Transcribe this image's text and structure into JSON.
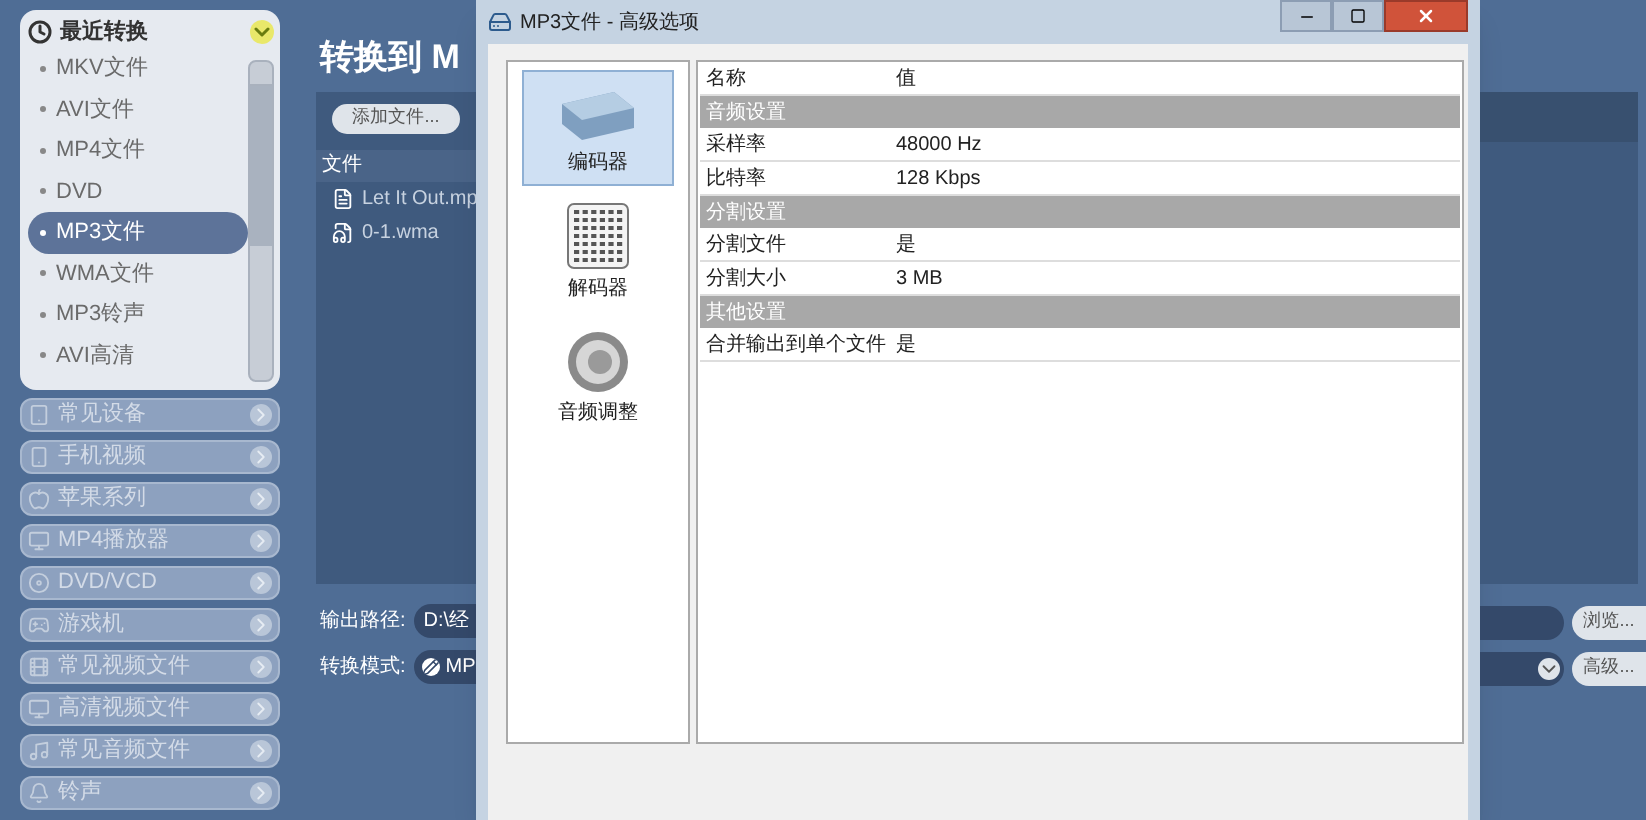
{
  "sidebar": {
    "recent": {
      "title": "最近转换",
      "items": [
        {
          "label": "MKV文件",
          "selected": false
        },
        {
          "label": "AVI文件",
          "selected": false
        },
        {
          "label": "MP4文件",
          "selected": false
        },
        {
          "label": "DVD",
          "selected": false
        },
        {
          "label": "MP3文件",
          "selected": true
        },
        {
          "label": "WMA文件",
          "selected": false
        },
        {
          "label": "MP3铃声",
          "selected": false
        },
        {
          "label": "AVI高清",
          "selected": false
        }
      ]
    },
    "categories": [
      {
        "label": "常见设备",
        "kind": "device"
      },
      {
        "label": "手机视频",
        "kind": "phone"
      },
      {
        "label": "苹果系列",
        "kind": "apple"
      },
      {
        "label": "MP4播放器",
        "kind": "player"
      },
      {
        "label": "DVD/VCD",
        "kind": "disc"
      },
      {
        "label": "游戏机",
        "kind": "game"
      },
      {
        "label": "常见视频文件",
        "kind": "video"
      },
      {
        "label": "高清视频文件",
        "kind": "hd"
      },
      {
        "label": "常见音频文件",
        "kind": "audio"
      },
      {
        "label": "铃声",
        "kind": "ring"
      }
    ]
  },
  "main": {
    "title": "转换到 M",
    "add_button": "添加文件...",
    "file_column": "文件",
    "files": [
      {
        "name": "Let It Out.mp",
        "kind": "document"
      },
      {
        "name": "0-1.wma",
        "kind": "audio"
      }
    ],
    "output_path_label": "输出路径:",
    "output_path": "D:\\经",
    "mode_label": "转换模式:",
    "mode": "MP",
    "browse_button": "浏览...",
    "advanced_button": "高级..."
  },
  "dialog": {
    "title": "MP3文件 - 高级选项",
    "nav": [
      {
        "label": "编码器",
        "kind": "encoder",
        "selected": true
      },
      {
        "label": "解码器",
        "kind": "decoder",
        "selected": false
      },
      {
        "label": "音频调整",
        "kind": "audio",
        "selected": false
      }
    ],
    "table": {
      "columns": [
        "名称",
        "值"
      ],
      "rows": [
        {
          "kind": "section",
          "name": "音频设置"
        },
        {
          "kind": "row",
          "name": "采样率",
          "value": "48000 Hz"
        },
        {
          "kind": "row",
          "name": "比特率",
          "value": "128 Kbps"
        },
        {
          "kind": "section",
          "name": "分割设置"
        },
        {
          "kind": "row",
          "name": "分割文件",
          "value": "是"
        },
        {
          "kind": "row",
          "name": "分割大小",
          "value": "3 MB"
        },
        {
          "kind": "section",
          "name": "其他设置"
        },
        {
          "kind": "row",
          "name": "合并输出到单个文件",
          "value": "是"
        }
      ]
    }
  }
}
